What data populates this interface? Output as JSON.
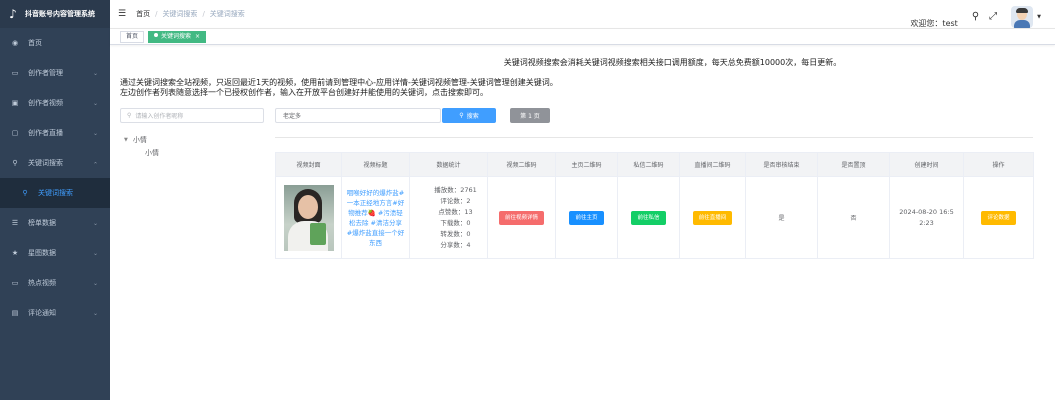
{
  "app": {
    "name": "抖音账号内容管理系统"
  },
  "sidebar": {
    "items": [
      {
        "label": "首页",
        "icon": "dashboard-icon"
      },
      {
        "label": "创作者管理",
        "icon": "tv-icon"
      },
      {
        "label": "创作者视频",
        "icon": "video-icon"
      },
      {
        "label": "创作者直播",
        "icon": "monitor-icon"
      },
      {
        "label": "关键词搜索",
        "icon": "search-icon"
      },
      {
        "label": "关键词搜索",
        "icon": "search-icon"
      },
      {
        "label": "榜单数据",
        "icon": "list-icon"
      },
      {
        "label": "星图数据",
        "icon": "star-icon"
      },
      {
        "label": "热点视频",
        "icon": "hot-video-icon"
      },
      {
        "label": "评论通知",
        "icon": "comment-icon"
      }
    ]
  },
  "header": {
    "breadcrumb": [
      "首页",
      "关键词搜索",
      "关键词搜索"
    ],
    "welcome": "欢迎您：test"
  },
  "tags": {
    "home": "首页",
    "active": "关键词搜索"
  },
  "main": {
    "notice": "关键词视频搜索会消耗关键词视频搜索相关接口调用额度，每天总免费额10000次，每日更新。",
    "intro_line1": "通过关键词搜索全站视频，只返回最近1天的视频，使用前请到管理中心-应用详情-关键词视频管理-关键词管理创建关键词。",
    "intro_line2": "左边创作者列表随意选择一个已授权创作者，输入在开放平台创建好并能使用的关键词，点击搜索即可。",
    "creator_search_placeholder": "请输入创作者昵称",
    "tree": {
      "parent": "小情",
      "child": "小情"
    },
    "keyword_value": "老定多",
    "search_button": "搜索",
    "page_button": "第 1 页"
  },
  "table": {
    "columns": [
      "视频封面",
      "视频标题",
      "数据统计",
      "视频二维码",
      "主页二维码",
      "私信二维码",
      "直播间二维码",
      "是否审核结束",
      "是否置顶",
      "创建时间",
      "操作"
    ],
    "rows": [
      {
        "title": "咽喉好好的爆炸盐#一本正经地方言#好物推荐🍓 #污渍轻松去除 #清洁分享 #爆炸盐直接一个好东西",
        "stats": {
          "play": "播放数：2761",
          "comment": "评论数：2",
          "like": "点赞数：13",
          "download": "下载数：0",
          "forward": "转发数：0",
          "share": "分享数：4"
        },
        "btn_video": "前往视频详情",
        "btn_home": "前往主页",
        "btn_msg": "前往私信",
        "btn_live": "前往直播间",
        "review_done": "是",
        "pinned": "否",
        "created_line1": "2024-08-20 16:5",
        "created_line2": "2:23",
        "btn_comment": "评论数据"
      }
    ]
  },
  "colors": {
    "sidebar_bg": "#304156",
    "primary": "#409eff",
    "tag_active": "#42b983",
    "danger": "#f56c6c",
    "success": "#13ce66",
    "warning": "#ffba00"
  }
}
